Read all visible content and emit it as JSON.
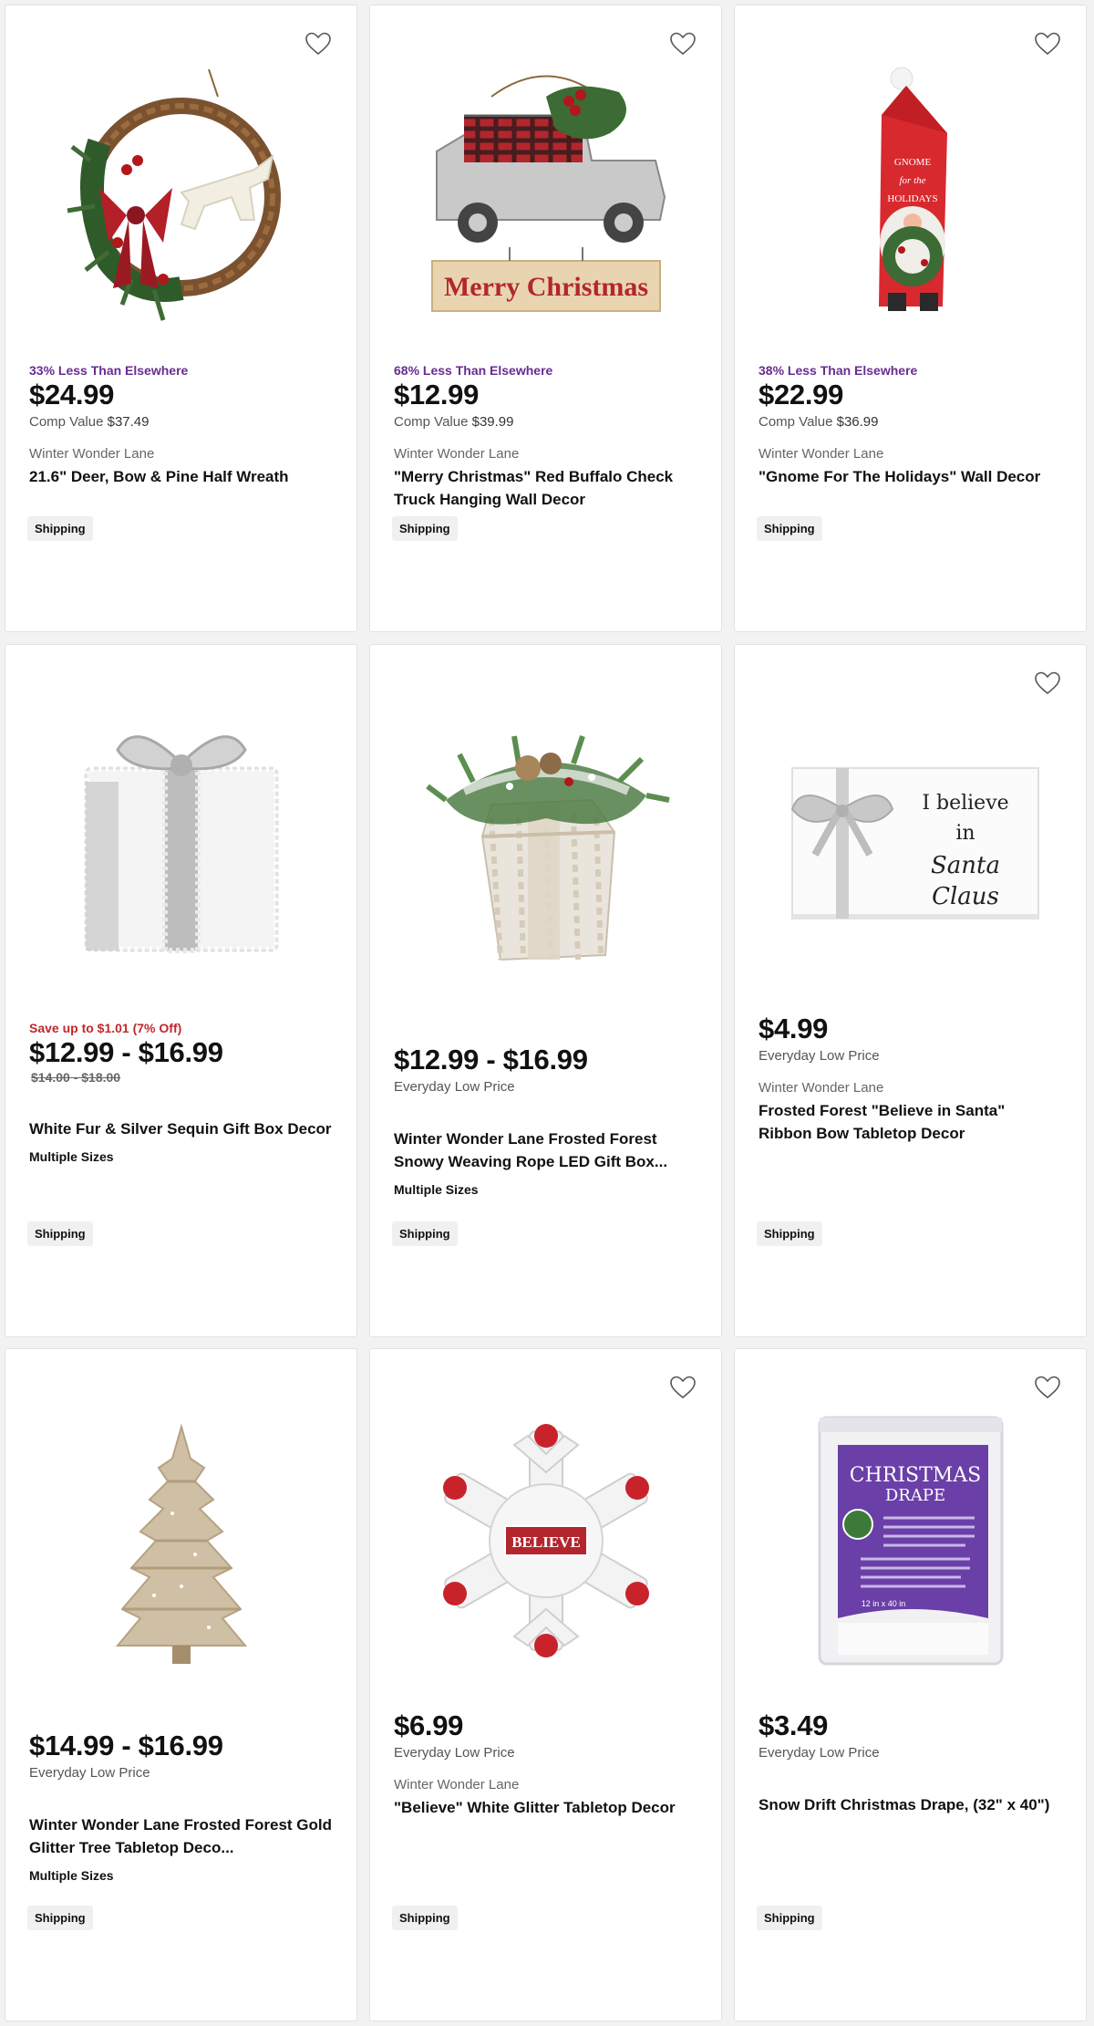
{
  "products": [
    {
      "deal": "33% Less Than Elsewhere",
      "price": "$24.99",
      "comp_label": "Comp Value",
      "comp_value": "$37.49",
      "brand": "Winter Wonder Lane",
      "title": "21.6\" Deer, Bow & Pine Half Wreath",
      "shipping": "Shipping",
      "icon": "wreath-image"
    },
    {
      "deal": "68% Less Than Elsewhere",
      "price": "$12.99",
      "comp_label": "Comp Value",
      "comp_value": "$39.99",
      "brand": "Winter Wonder Lane",
      "title": "\"Merry Christmas\" Red Buffalo Check Truck Hanging Wall Decor",
      "shipping": "Shipping",
      "image_text": "Merry Christmas",
      "icon": "truck-sign-image"
    },
    {
      "deal": "38% Less Than Elsewhere",
      "price": "$22.99",
      "comp_label": "Comp Value",
      "comp_value": "$36.99",
      "brand": "Winter Wonder Lane",
      "title": "\"Gnome For The Holidays\" Wall Decor",
      "shipping": "Shipping",
      "image_text": "GNOME for the HOLIDAYS",
      "icon": "gnome-image"
    },
    {
      "sale": "Save up to  $1.01 (7% Off)",
      "price": "$12.99 - $16.99",
      "was": "$14.00 - $18.00",
      "title": "White Fur & Silver Sequin Gift Box Decor",
      "multi": "Multiple Sizes",
      "shipping": "Shipping",
      "icon": "gift-box-image"
    },
    {
      "price": "$12.99 - $16.99",
      "sub": "Everyday Low Price",
      "title": "Winter Wonder Lane Frosted Forest Snowy Weaving Rope LED Gift Box...",
      "multi": "Multiple Sizes",
      "shipping": "Shipping",
      "icon": "rope-gift-box-image"
    },
    {
      "price": "$4.99",
      "sub": "Everyday Low Price",
      "brand": "Winter Wonder Lane",
      "title": "Frosted Forest \"Believe in Santa\" Ribbon Bow Tabletop Decor",
      "shipping": "Shipping",
      "image_text_1": "I believe",
      "image_text_2": "in",
      "image_text_3": "Santa",
      "image_text_4": "Claus",
      "icon": "believe-sign-image"
    },
    {
      "price": "$14.99 - $16.99",
      "sub": "Everyday Low Price",
      "title": "Winter Wonder Lane Frosted Forest Gold Glitter Tree Tabletop Deco...",
      "multi": "Multiple Sizes",
      "shipping": "Shipping",
      "icon": "glitter-tree-image"
    },
    {
      "price": "$6.99",
      "sub": "Everyday Low Price",
      "brand": "Winter Wonder Lane",
      "title": "\"Believe\" White Glitter Tabletop Decor",
      "shipping": "Shipping",
      "image_text": "BELIEVE",
      "icon": "snowflake-image"
    },
    {
      "price": "$3.49",
      "sub": "Everyday Low Price",
      "title": "Snow Drift Christmas Drape, (32\" x 40\")",
      "shipping": "Shipping",
      "image_text_1": "CHRISTMAS",
      "image_text_2": "DRAPE",
      "image_text_3": "12 in x 40 in",
      "icon": "drape-package-image"
    }
  ],
  "colors": {
    "deal": "#6a2c91",
    "sale": "#c0282d"
  }
}
